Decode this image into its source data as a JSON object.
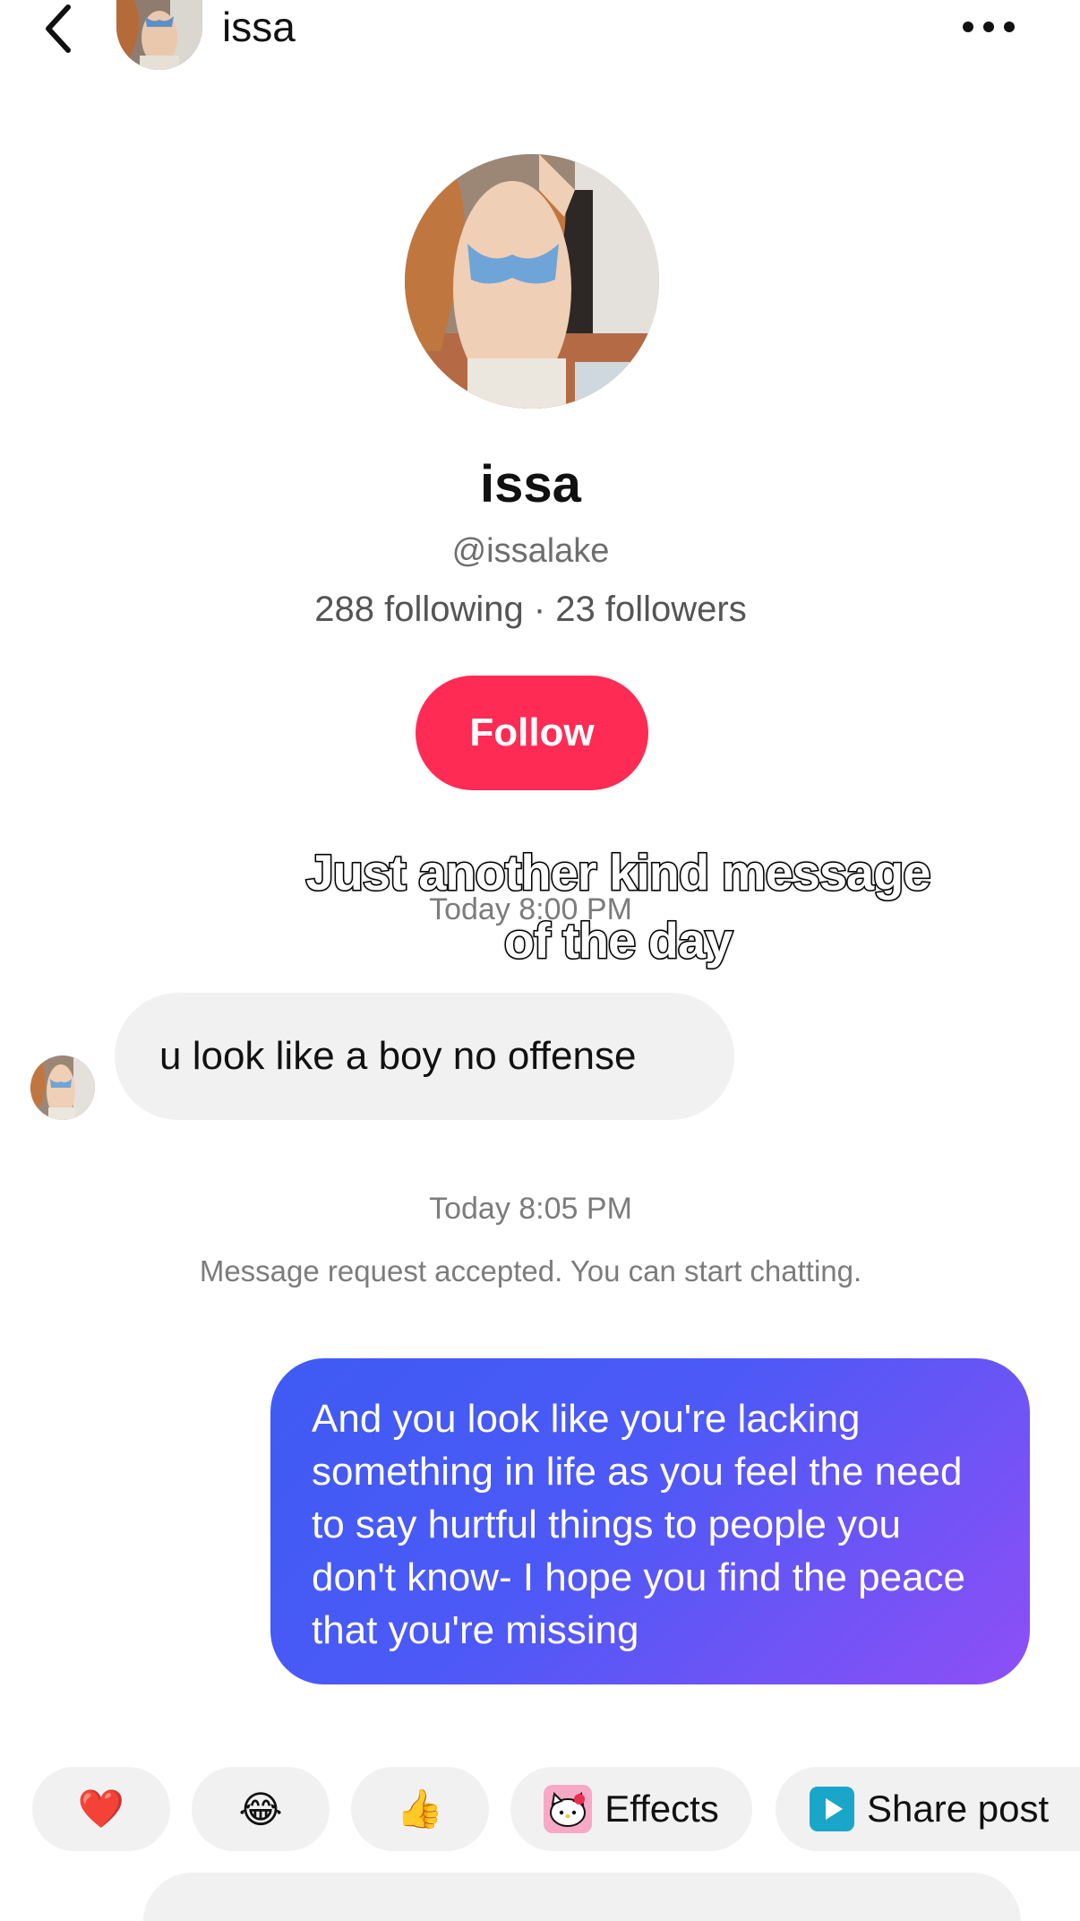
{
  "header": {
    "name": "issa",
    "back_icon": "chevron-left-icon",
    "more_icon": "more-horizontal-icon"
  },
  "profile": {
    "name": "issa",
    "handle": "@issalake",
    "stats": "288 following · 23 followers",
    "follow_label": "Follow"
  },
  "overlay_caption": {
    "line1": "Just another kind message",
    "line2": "of the day"
  },
  "messages": {
    "timestamp_1": "Today 8:00 PM",
    "incoming_text": "u look like a boy no offense",
    "timestamp_2": "Today 8:05 PM",
    "system_text": "Message request accepted. You can start chatting.",
    "outgoing_text": "And you look like you're lacking something in life as you feel the need to say hurtful things to people you don't know- I hope you find the peace that you're missing"
  },
  "quick_reactions": {
    "heart": "❤️",
    "laugh": "😂",
    "thumbs_up": "👍",
    "effects_label": "Effects",
    "share_label": "Share post"
  },
  "colors": {
    "follow_button": "#fe2c55",
    "outgoing_bubble_start": "#3e5bf4",
    "outgoing_bubble_end": "#8e4ff6",
    "incoming_bubble": "#f1f1f2",
    "muted_text": "#7c7c7c"
  }
}
